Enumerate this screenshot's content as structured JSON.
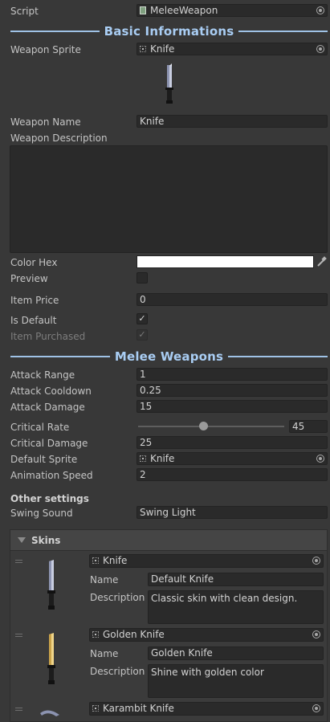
{
  "script": {
    "label": "Script",
    "value": "MeleeWeapon",
    "icon": "script-icon"
  },
  "sections": {
    "basic": "Basic Informations",
    "melee": "Melee Weapons"
  },
  "basic": {
    "weapon_sprite_label": "Weapon Sprite",
    "weapon_sprite_value": "Knife",
    "weapon_name_label": "Weapon Name",
    "weapon_name_value": "Knife",
    "weapon_description_label": "Weapon Description",
    "weapon_description_value": "",
    "color_hex_label": "Color Hex",
    "color_hex_value": "#FFFFFF",
    "preview_label": "Preview",
    "preview_checked": false,
    "item_price_label": "Item Price",
    "item_price_value": "0",
    "is_default_label": "Is Default",
    "is_default_checked": true,
    "item_purchased_label": "Item Purchased",
    "item_purchased_checked": true
  },
  "melee": {
    "attack_range_label": "Attack Range",
    "attack_range_value": "1",
    "attack_cooldown_label": "Attack Cooldown",
    "attack_cooldown_value": "0.25",
    "attack_damage_label": "Attack Damage",
    "attack_damage_value": "15",
    "critical_rate_label": "Critical Rate",
    "critical_rate_value": "45",
    "critical_rate_fraction": 0.45,
    "critical_damage_label": "Critical Damage",
    "critical_damage_value": "25",
    "default_sprite_label": "Default Sprite",
    "default_sprite_value": "Knife",
    "animation_speed_label": "Animation Speed",
    "animation_speed_value": "2"
  },
  "other": {
    "heading": "Other settings",
    "swing_sound_label": "Swing Sound",
    "swing_sound_value": "Swing Light"
  },
  "skins": {
    "title": "Skins",
    "name_label": "Name",
    "description_label": "Description",
    "items": [
      {
        "sprite": "Knife",
        "name": "Default Knife",
        "description": "Classic skin with clean design."
      },
      {
        "sprite": "Golden Knife",
        "name": "Golden Knife",
        "description": "Shine with golden color"
      },
      {
        "sprite": "Karambit Knife"
      }
    ]
  },
  "colors": {
    "accent_header": "#a9cdf3",
    "background": "#383838",
    "field": "#2a2a2a"
  }
}
